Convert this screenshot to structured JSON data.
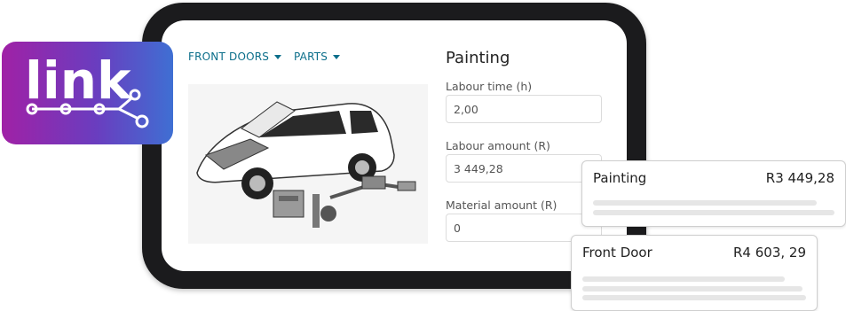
{
  "logo": {
    "text": "link"
  },
  "nav": {
    "front_doors": "FRONT DOORS",
    "parts": "PARTS"
  },
  "form": {
    "title": "Painting",
    "labour_time_label": "Labour time (h)",
    "labour_time_value": "2,00",
    "labour_amount_label": "Labour amount (R)",
    "labour_amount_value": "3 449,28",
    "material_amount_label": "Material amount (R)",
    "material_amount_value": "0"
  },
  "cards": [
    {
      "title": "Painting",
      "amount": "R3 449,28"
    },
    {
      "title": "Front Door",
      "amount": "R4 603, 29"
    }
  ],
  "colors": {
    "accent": "#0b6e8a",
    "logo_gradient_start": "#a021a6",
    "logo_gradient_end": "#3f6fd3",
    "frame": "#1b1b1d"
  }
}
